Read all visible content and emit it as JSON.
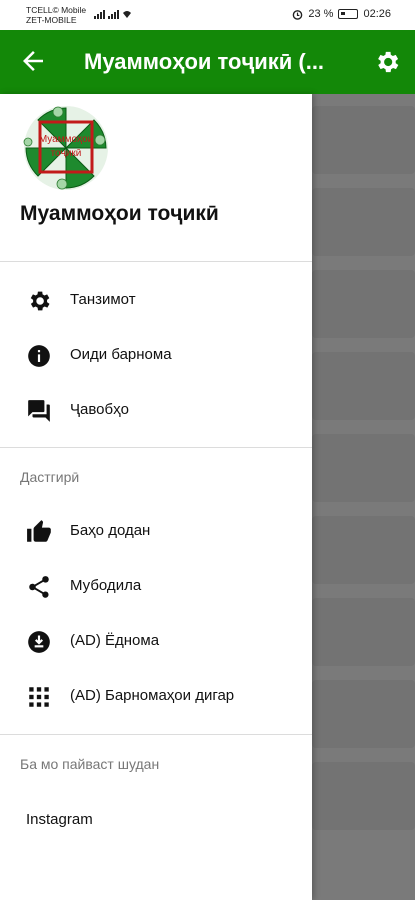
{
  "status": {
    "carrier1": "TCELL© Mobile",
    "carrier2": "ZET-MOBILE",
    "battery": "23 %",
    "time": "02:26"
  },
  "appbar": {
    "title": "Муаммоҳои тоҷикӣ (...",
    "color": "#138808"
  },
  "drawer": {
    "logo_text": "Муаммоҳои тоҷикӣ",
    "header_title": "Муаммоҳои тоҷикӣ",
    "items": [
      {
        "label": "Танзимот",
        "icon": "gear-icon"
      },
      {
        "label": "Оиди барнома",
        "icon": "info-icon"
      },
      {
        "label": "Ҷавобҳо",
        "icon": "chat-icon"
      }
    ],
    "section_support": "Дастгирӣ",
    "support_items": [
      {
        "label": "Баҳо додан",
        "icon": "thumb-up-icon"
      },
      {
        "label": "Мубодила",
        "icon": "share-icon"
      },
      {
        "label": "(AD) Ёднома",
        "icon": "download-icon"
      },
      {
        "label": "(AD) Барномаҳои дигар",
        "icon": "apps-grid-icon"
      }
    ],
    "section_contact": "Ба мо пайваст шудан",
    "contact_items": [
      {
        "label": "Instagram"
      }
    ]
  }
}
